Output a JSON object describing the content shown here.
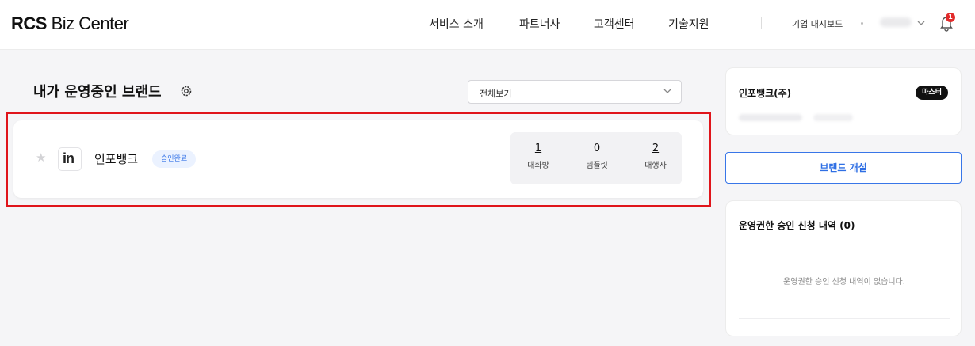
{
  "header": {
    "logo_bold": "RCS",
    "logo_rest": " Biz Center",
    "nav": [
      "서비스 소개",
      "파트너사",
      "고객센터",
      "기술지원"
    ],
    "dashboard_label": "기업 대시보드",
    "notification_count": "1"
  },
  "main": {
    "title": "내가 운영중인 브랜드",
    "filter": {
      "selected": "전체보기"
    },
    "brands": [
      {
        "logo_text": "in",
        "name": "인포뱅크",
        "status": "승인완료",
        "stats": [
          {
            "value": "1",
            "label": "대화방"
          },
          {
            "value": "0",
            "label": "템플릿"
          },
          {
            "value": "2",
            "label": "대행사"
          }
        ]
      }
    ]
  },
  "sidebar": {
    "company_name": "인포뱅크(주)",
    "role_badge": "마스터",
    "open_brand_label": "브랜드 개설",
    "requests_title": "운영권한 승인 신청 내역 (0)",
    "requests_empty": "운영권한 승인 신청 내역이 없습니다."
  },
  "colors": {
    "accent": "#3876e8",
    "highlight": "#e0151b",
    "badge_bg": "#ebf2ff"
  }
}
